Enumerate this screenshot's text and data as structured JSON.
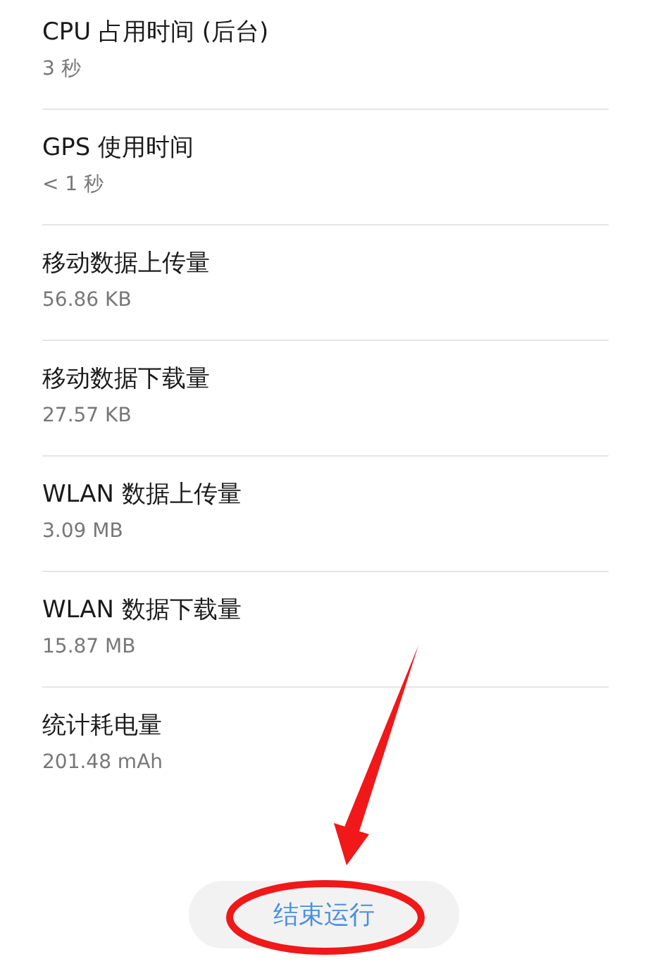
{
  "stats": [
    {
      "label": "CPU 占用时间 (后台)",
      "value": "3 秒"
    },
    {
      "label": "GPS 使用时间",
      "value": "< 1 秒"
    },
    {
      "label": "移动数据上传量",
      "value": "56.86 KB"
    },
    {
      "label": "移动数据下载量",
      "value": "27.57 KB"
    },
    {
      "label": "WLAN 数据上传量",
      "value": "3.09 MB"
    },
    {
      "label": "WLAN 数据下载量",
      "value": "15.87 MB"
    },
    {
      "label": "统计耗电量",
      "value": "201.48 mAh"
    }
  ],
  "stop_button": {
    "label": "结束运行"
  }
}
